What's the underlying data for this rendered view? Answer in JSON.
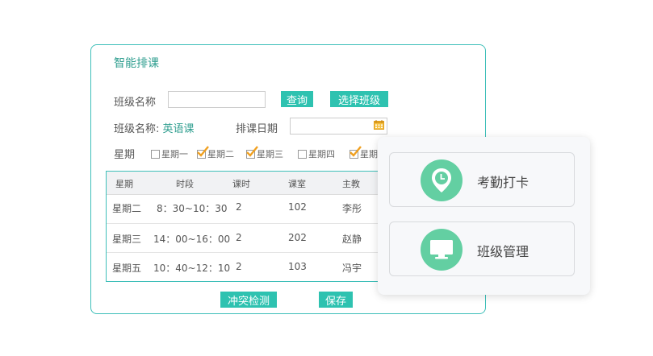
{
  "panel": {
    "title": "智能排课",
    "class_name_label": "班级名称",
    "class_name_value": "",
    "query_button": "查询",
    "select_class_button": "选择班级",
    "class_name_display_label": "班级名称:",
    "class_name_display_value": "英语课",
    "schedule_date_label": "排课日期",
    "schedule_date_value": "",
    "weekday_label": "星期",
    "weekdays": [
      {
        "label": "星期一",
        "checked": false
      },
      {
        "label": "星期二",
        "checked": true
      },
      {
        "label": "星期三",
        "checked": true
      },
      {
        "label": "星期四",
        "checked": false
      },
      {
        "label": "星期",
        "checked": true
      }
    ],
    "conflict_button": "冲突检测",
    "save_button": "保存"
  },
  "table": {
    "headers": [
      "星期",
      "时段",
      "课时",
      "课室",
      "主教"
    ],
    "rows": [
      [
        "星期二",
        "8：30~10：30",
        "2",
        "102",
        "李彤"
      ],
      [
        "星期三",
        "14：00~16：00",
        "2",
        "202",
        "赵静"
      ],
      [
        "星期五",
        "10：40~12：10",
        "2",
        "103",
        "冯宇"
      ]
    ]
  },
  "side": {
    "attendance_label": "考勤打卡",
    "class_manage_label": "班级管理"
  },
  "colors": {
    "accent": "#2ec2b0",
    "border": "#3ebfb9",
    "icon_circle": "#63cfa2",
    "check_orange": "#f0a020"
  },
  "icons": {
    "attendance": "location-clock-icon",
    "class_manage": "monitor-icon",
    "date": "calendar-icon"
  }
}
